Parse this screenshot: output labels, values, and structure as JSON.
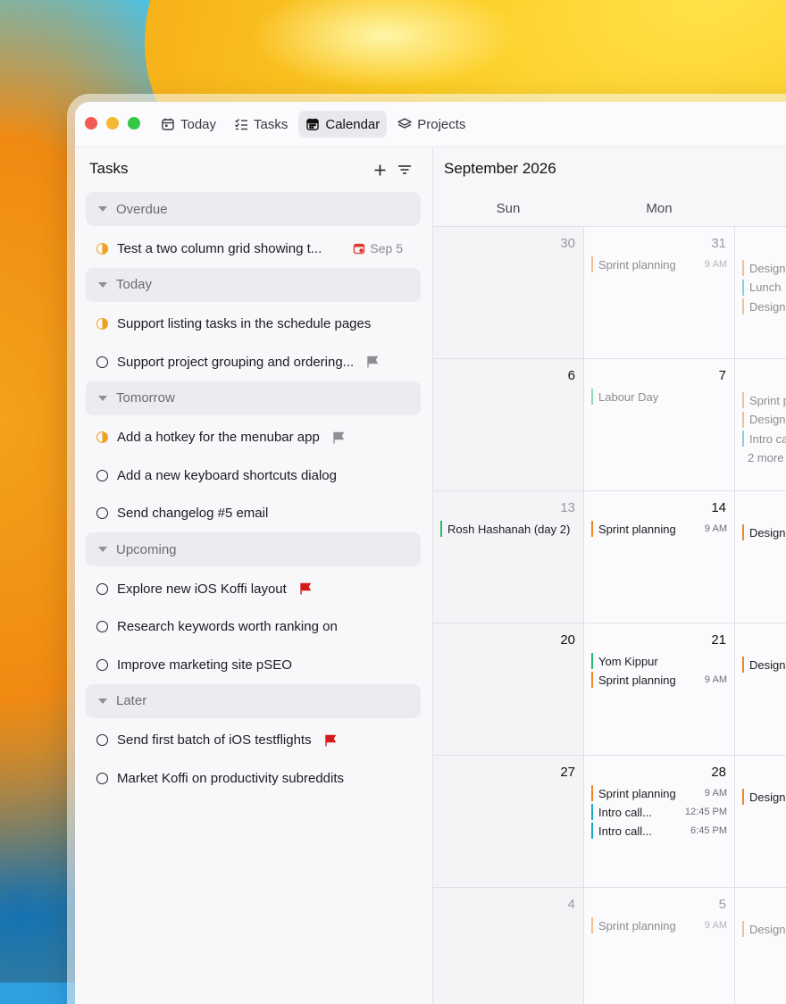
{
  "nav": {
    "items": [
      {
        "label": "Today",
        "icon": "calendar-day-icon"
      },
      {
        "label": "Tasks",
        "icon": "checklist-icon"
      },
      {
        "label": "Calendar",
        "icon": "calendar-icon",
        "active": true
      },
      {
        "label": "Projects",
        "icon": "layers-icon"
      }
    ]
  },
  "sidebar": {
    "title": "Tasks",
    "groups": [
      {
        "name": "Overdue",
        "tasks": [
          {
            "text": "Test a two column grid showing t...",
            "status": "in-progress",
            "due": "Sep 5",
            "due_color": "#e0342f"
          }
        ]
      },
      {
        "name": "Today",
        "tasks": [
          {
            "text": "Support listing tasks in the schedule pages",
            "status": "in-progress"
          },
          {
            "text": "Support project grouping and ordering...",
            "status": "open",
            "flag": "#8e8e95"
          }
        ]
      },
      {
        "name": "Tomorrow",
        "tasks": [
          {
            "text": "Add a hotkey for the menubar app",
            "status": "in-progress",
            "flag": "#8e8e95"
          },
          {
            "text": "Add a new keyboard shortcuts dialog",
            "status": "open"
          },
          {
            "text": "Send changelog #5 email",
            "status": "open"
          }
        ]
      },
      {
        "name": "Upcoming",
        "tasks": [
          {
            "text": "Explore new iOS Koffi layout",
            "status": "open",
            "flag": "#d51a1a"
          },
          {
            "text": "Research keywords worth ranking on",
            "status": "open"
          },
          {
            "text": "Improve marketing site pSEO",
            "status": "open"
          }
        ]
      },
      {
        "name": "Later",
        "tasks": [
          {
            "text": "Send first batch of iOS testflights",
            "status": "open",
            "flag": "#d51a1a"
          },
          {
            "text": "Market Koffi on productivity subreddits",
            "status": "open"
          }
        ]
      }
    ]
  },
  "calendar": {
    "month": "September 2026",
    "weekdays": [
      "Sun",
      "Mon"
    ],
    "weeks": [
      {
        "sun": {
          "day": "30",
          "dim": true,
          "events": []
        },
        "mon": {
          "day": "31",
          "dim": true,
          "events": [
            {
              "title": "Sprint planning",
              "time": "9 AM",
              "color": "orange",
              "faded": true
            }
          ]
        },
        "tue": {
          "events": [
            {
              "title": "Design",
              "color": "orange",
              "faded": true
            },
            {
              "title": "Lunch",
              "color": "cyan",
              "faded": true
            },
            {
              "title": "Design",
              "color": "orange",
              "faded": true
            }
          ]
        }
      },
      {
        "sun": {
          "day": "6",
          "dim": false,
          "events": []
        },
        "mon": {
          "day": "7",
          "dim": false,
          "events": [
            {
              "title": "Labour Day",
              "color": "green",
              "faded": true
            }
          ]
        },
        "tue": {
          "events": [
            {
              "title": "Sprint p",
              "color": "orange",
              "faded": true
            },
            {
              "title": "Design",
              "color": "orange",
              "faded": true
            },
            {
              "title": "Intro ca",
              "color": "cyan",
              "faded": true
            }
          ],
          "more": "2 more"
        }
      },
      {
        "sun": {
          "day": "13",
          "dim": true,
          "events": [
            {
              "title": "Rosh Hashanah (day 2)",
              "color": "green"
            }
          ]
        },
        "mon": {
          "day": "14",
          "dim": false,
          "events": [
            {
              "title": "Sprint planning",
              "time": "9 AM",
              "color": "orange"
            }
          ]
        },
        "tue": {
          "events": [
            {
              "title": "Design",
              "color": "orange"
            }
          ]
        }
      },
      {
        "sun": {
          "day": "20",
          "dim": false,
          "events": []
        },
        "mon": {
          "day": "21",
          "dim": false,
          "events": [
            {
              "title": "Yom Kippur",
              "color": "green"
            },
            {
              "title": "Sprint planning",
              "time": "9 AM",
              "color": "orange"
            }
          ]
        },
        "tue": {
          "events": [
            {
              "title": "Design",
              "color": "orange"
            }
          ]
        }
      },
      {
        "sun": {
          "day": "27",
          "dim": false,
          "events": []
        },
        "mon": {
          "day": "28",
          "dim": false,
          "events": [
            {
              "title": "Sprint planning",
              "time": "9 AM",
              "color": "orange"
            },
            {
              "title": "Intro call...",
              "time": "12:45 PM",
              "color": "cyan"
            },
            {
              "title": "Intro call...",
              "time": "6:45 PM",
              "color": "cyan"
            }
          ]
        },
        "tue": {
          "events": [
            {
              "title": "Design",
              "color": "orange"
            }
          ]
        }
      },
      {
        "sun": {
          "day": "4",
          "dim": true,
          "events": []
        },
        "mon": {
          "day": "5",
          "dim": true,
          "events": [
            {
              "title": "Sprint planning",
              "time": "9 AM",
              "color": "orange",
              "faded": true
            }
          ]
        },
        "tue": {
          "events": [
            {
              "title": "Design",
              "color": "orange",
              "faded": true
            }
          ]
        }
      }
    ]
  }
}
